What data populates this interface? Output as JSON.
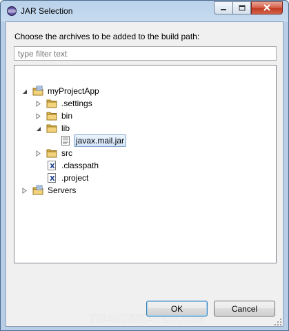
{
  "window": {
    "title": "JAR Selection"
  },
  "dialog": {
    "instruction": "Choose the archives to be added to the build path:",
    "filter": {
      "placeholder": "type filter text",
      "value": ""
    }
  },
  "tree": {
    "project": {
      "label": "myProjectApp",
      "expanded": true,
      "icon": "project-folder-icon"
    },
    "settings": {
      "label": ".settings",
      "expanded": false,
      "icon": "folder-icon"
    },
    "bin": {
      "label": "bin",
      "expanded": false,
      "icon": "folder-icon"
    },
    "lib": {
      "label": "lib",
      "expanded": true,
      "icon": "folder-icon"
    },
    "jar": {
      "label": "javax.mail.jar",
      "selected": true,
      "icon": "jar-file-icon"
    },
    "src": {
      "label": "src",
      "expanded": false,
      "icon": "folder-icon"
    },
    "classpath": {
      "label": ".classpath",
      "icon": "xml-file-icon"
    },
    "projectfile": {
      "label": ".project",
      "icon": "xml-file-icon"
    },
    "servers": {
      "label": "Servers",
      "expanded": false,
      "icon": "project-folder-icon"
    }
  },
  "buttons": {
    "ok": "OK",
    "cancel": "Cancel"
  },
  "watermark": "THAICREATE.COM",
  "colors": {
    "selection": "#d3e5fb",
    "folder": "#e8c25a",
    "titlebar": "#c7dcf0",
    "close": "#c23b22"
  }
}
